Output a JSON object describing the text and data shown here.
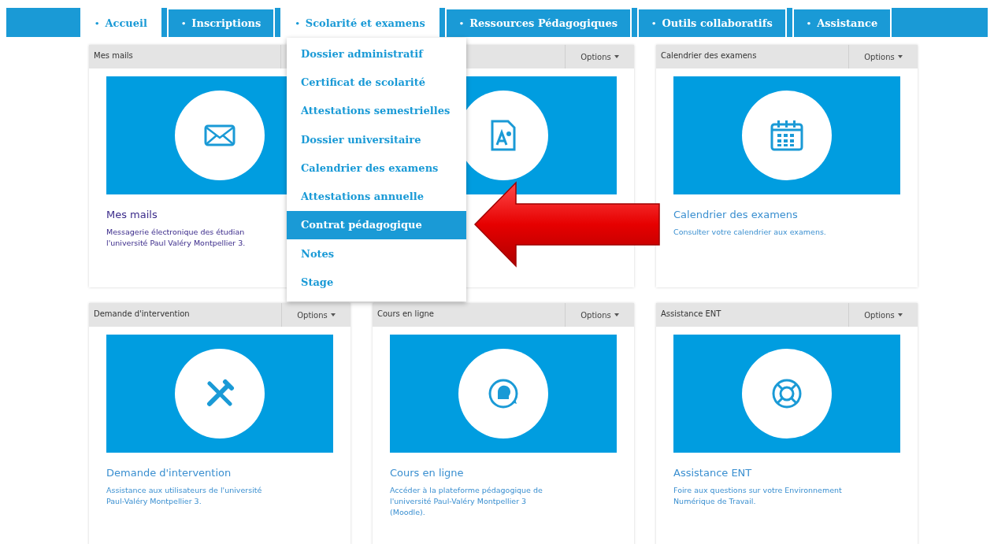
{
  "nav": {
    "tabs": [
      {
        "bullet": "•",
        "label": "Accueil",
        "selected": true
      },
      {
        "bullet": "•",
        "label": "Inscriptions",
        "selected": false
      },
      {
        "bullet": "•",
        "label": "Scolarité et examens",
        "selected": true
      },
      {
        "bullet": "•",
        "label": "Ressources Pédagogiques",
        "selected": false
      },
      {
        "bullet": "•",
        "label": "Outils collaboratifs",
        "selected": false
      },
      {
        "bullet": "•",
        "label": "Assistance",
        "selected": false
      }
    ]
  },
  "dropdown": {
    "items": [
      {
        "label": "Dossier administratif",
        "selected": false
      },
      {
        "label": "Certificat de scolarité",
        "selected": false
      },
      {
        "label": "Attestations semestrielles",
        "selected": false
      },
      {
        "label": "Dossier universitaire",
        "selected": false
      },
      {
        "label": "Calendrier des examens",
        "selected": false
      },
      {
        "label": "Attestations annuelle",
        "selected": false
      },
      {
        "label": "Contrat pédagogique",
        "selected": true
      },
      {
        "label": "Notes",
        "selected": false
      },
      {
        "label": "Stage",
        "selected": false
      }
    ]
  },
  "cards": [
    {
      "header": "Mes mails",
      "kind": "mail",
      "title": "Mes mails",
      "visited": true,
      "description": [
        "Messagerie électronique des étudian",
        "l'université Paul Valéry Montpellier 3."
      ]
    },
    {
      "options": "Options",
      "kind": "document"
    },
    {
      "header": "Calendrier des examens",
      "options": "Options",
      "kind": "calendar",
      "title": "Calendrier des examens",
      "visited": false,
      "description": [
        "Consulter votre calendrier aux examens."
      ]
    },
    {
      "header": "Demande d'intervention",
      "options": "Options",
      "kind": "tools",
      "title": "Demande d'intervention",
      "visited": false,
      "description": [
        "Assistance aux utilisateurs de l'université",
        "Paul-Valéry Montpellier 3."
      ]
    },
    {
      "header": "Cours en ligne",
      "options": "Options",
      "kind": "head",
      "title": "Cours en ligne",
      "visited": false,
      "description": [
        "Accéder à la plateforme pédagogique de",
        "l'université Paul-Valéry Montpellier 3",
        "(Moodle)."
      ]
    },
    {
      "header": "Assistance ENT",
      "options": "Options",
      "kind": "lifebuoy",
      "title": "Assistance ENT",
      "visited": false,
      "description": [
        "Foire aux questions sur votre Environnement",
        "Numérique de Travail."
      ]
    }
  ]
}
